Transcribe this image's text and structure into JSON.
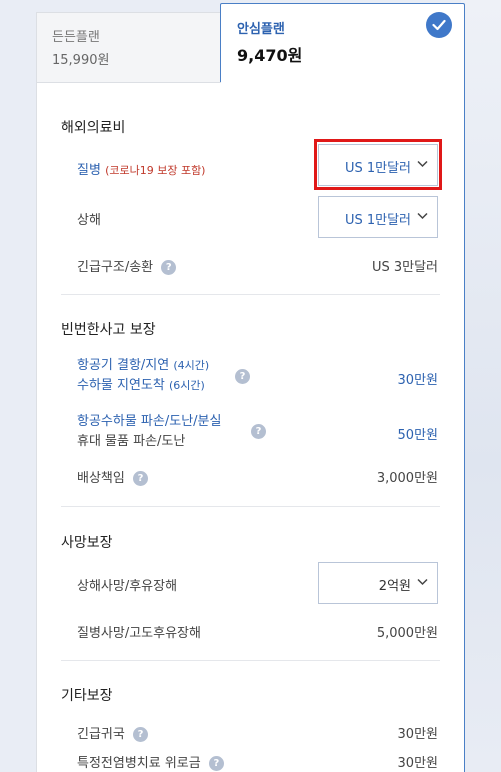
{
  "tabs": [
    {
      "name": "든든플랜",
      "price": "15,990원"
    },
    {
      "name": "안심플랜",
      "price": "9,470원"
    }
  ],
  "sections": {
    "medical": {
      "title": "해외의료비",
      "illness_label": "질병",
      "illness_note": "(코로나19 보장 포함)",
      "illness_value": "US 1만달러",
      "injury_label": "상해",
      "injury_value": "US 1만달러",
      "rescue_label": "긴급구조/송환",
      "rescue_value": "US 3만달러"
    },
    "accident": {
      "title": "빈번한사고 보장",
      "flight_label1": "항공기 결항/지연",
      "flight_note1": "(4시간)",
      "flight_label2": "수하물 지연도착",
      "flight_note2": "(6시간)",
      "flight_value": "30만원",
      "baggage_label1": "항공수하물 파손/도난/분실",
      "baggage_label2": "휴대 물품 파손/도난",
      "baggage_value": "50만원",
      "liability_label": "배상책임",
      "liability_value": "3,000만원"
    },
    "death": {
      "title": "사망보장",
      "injury_death_label": "상해사망/후유장해",
      "injury_death_value": "2억원",
      "illness_death_label": "질병사망/고도후유장해",
      "illness_death_value": "5,000만원"
    },
    "other": {
      "title": "기타보장",
      "return_label": "긴급귀국",
      "return_value": "30만원",
      "epidemic_label": "특정전염병치료 위로금",
      "epidemic_value": "30만원"
    }
  },
  "help_glyph": "?",
  "colors": {
    "accent": "#2d62b0",
    "highlight": "#e01818",
    "note_red": "#c0392b"
  }
}
